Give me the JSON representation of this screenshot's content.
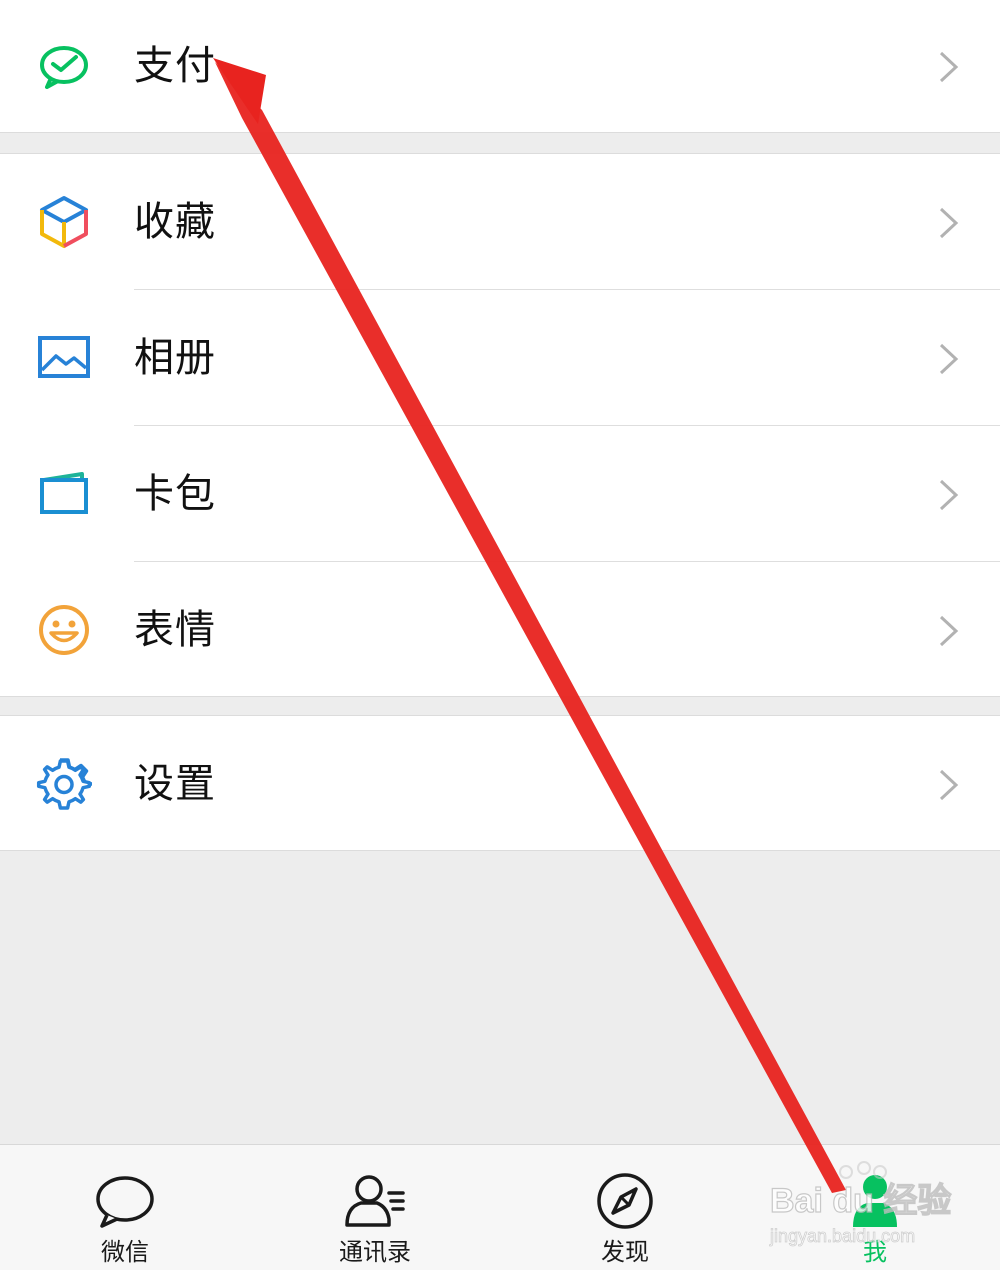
{
  "menu": {
    "pay": {
      "label": "支付",
      "icon": "wechat-pay-icon",
      "color": "#07c160"
    },
    "favorites": {
      "label": "收藏",
      "icon": "favorites-cube-icon"
    },
    "album": {
      "label": "相册",
      "icon": "album-picture-icon",
      "color": "#2782d7"
    },
    "cards": {
      "label": "卡包",
      "icon": "card-wallet-icon",
      "color": "#1a8fd2"
    },
    "stickers": {
      "label": "表情",
      "icon": "smiley-face-icon",
      "color": "#f2a33a"
    },
    "settings": {
      "label": "设置",
      "icon": "gear-icon",
      "color": "#2782d7"
    }
  },
  "tabbar": {
    "tabs": [
      {
        "label": "微信",
        "icon": "chat-bubble-icon",
        "active": false
      },
      {
        "label": "通讯录",
        "icon": "contacts-icon",
        "active": false
      },
      {
        "label": "发现",
        "icon": "compass-icon",
        "active": false
      },
      {
        "label": "我",
        "icon": "me-person-icon",
        "active": true
      }
    ],
    "active_color": "#07c160"
  },
  "annotation": {
    "arrow_color": "#e8231f"
  },
  "watermark": {
    "brand": "Bai du 经验",
    "url": "jingyan.baidu.com"
  }
}
